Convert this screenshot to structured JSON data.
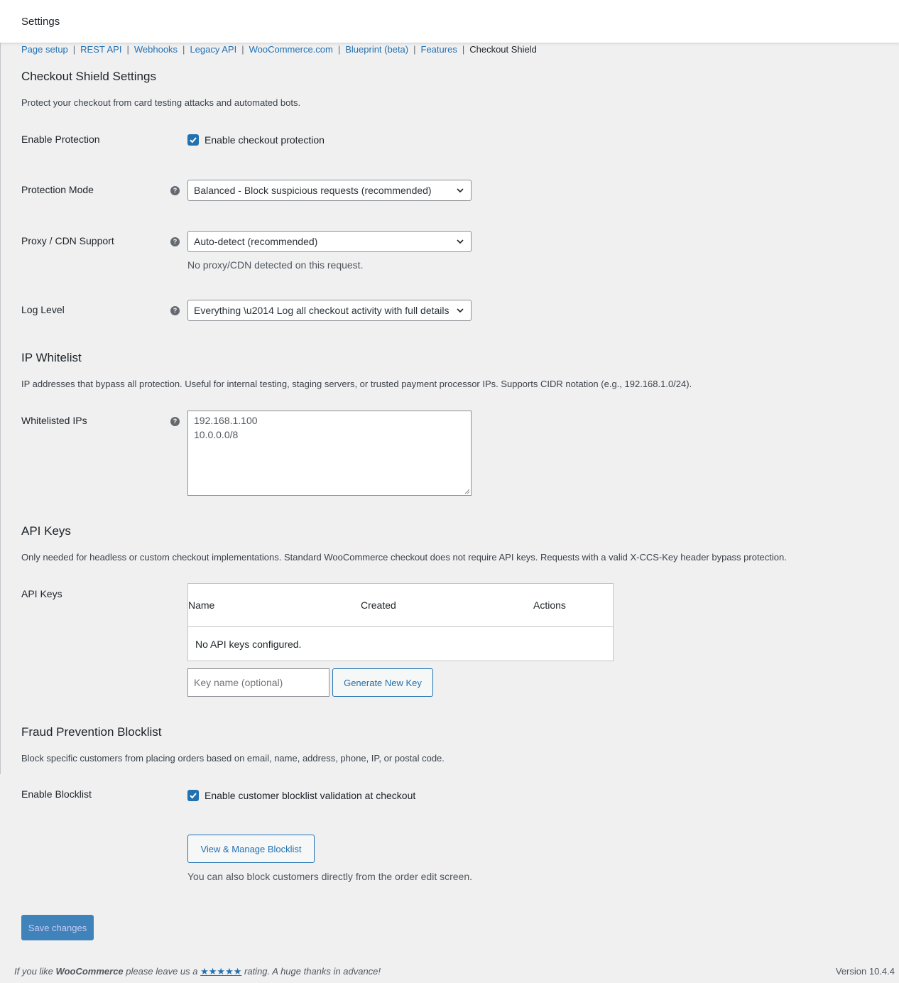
{
  "header": {
    "title": "Settings"
  },
  "subnav": {
    "links": [
      "Page setup",
      "REST API",
      "Webhooks",
      "Legacy API",
      "WooCommerce.com",
      "Blueprint (beta)",
      "Features"
    ],
    "current": "Checkout Shield",
    "separator": "|"
  },
  "main": {
    "title": "Checkout Shield Settings",
    "description": "Protect your checkout from card testing attacks and automated bots.",
    "enable_protection": {
      "label": "Enable Protection",
      "checkbox_label": "Enable checkout protection",
      "checked": true
    },
    "protection_mode": {
      "label": "Protection Mode",
      "selected": "Balanced - Block suspicious requests (recommended)"
    },
    "proxy_cdn": {
      "label": "Proxy / CDN Support",
      "selected": "Auto-detect (recommended)",
      "hint": "No proxy/CDN detected on this request."
    },
    "log_level": {
      "label": "Log Level",
      "selected": "Everything \\u2014 Log all checkout activity with full details"
    }
  },
  "ip_whitelist": {
    "title": "IP Whitelist",
    "description": "IP addresses that bypass all protection. Useful for internal testing, staging servers, or trusted payment processor IPs. Supports CIDR notation (e.g., 192.168.1.0/24).",
    "label": "Whitelisted IPs",
    "lines": [
      "192.168.1.100",
      "10.0.0.0/8"
    ]
  },
  "api_keys": {
    "title": "API Keys",
    "description": "Only needed for headless or custom checkout implementations. Standard WooCommerce checkout does not require API keys. Requests with a valid X-CCS-Key header bypass protection.",
    "label": "API Keys",
    "columns": [
      "Name",
      "Created",
      "Actions"
    ],
    "empty_text": "No API keys configured.",
    "input_placeholder": "Key name (optional)",
    "generate_button": "Generate New Key"
  },
  "blocklist": {
    "title": "Fraud Prevention Blocklist",
    "description": "Block specific customers from placing orders based on email, name, address, phone, IP, or postal code.",
    "label": "Enable Blocklist",
    "checkbox_label": "Enable customer blocklist validation at checkout",
    "checked": true,
    "manage_button": "View & Manage Blocklist",
    "hint": "You can also block customers directly from the order edit screen."
  },
  "save_button": "Save changes",
  "footer": {
    "text_before": "If you like",
    "brand": "WooCommerce",
    "text_middle": "please leave us a",
    "stars": "★★★★★",
    "text_after": "rating. A huge thanks in advance!",
    "version": "Version 10.4.4"
  },
  "colors": {
    "accent": "#2271b1",
    "background": "#f0f0f1",
    "text": "#1d2327"
  },
  "icons": {
    "help": "question-circle-icon",
    "select": "chevron-down-icon",
    "checkbox": "checkmark-icon"
  }
}
